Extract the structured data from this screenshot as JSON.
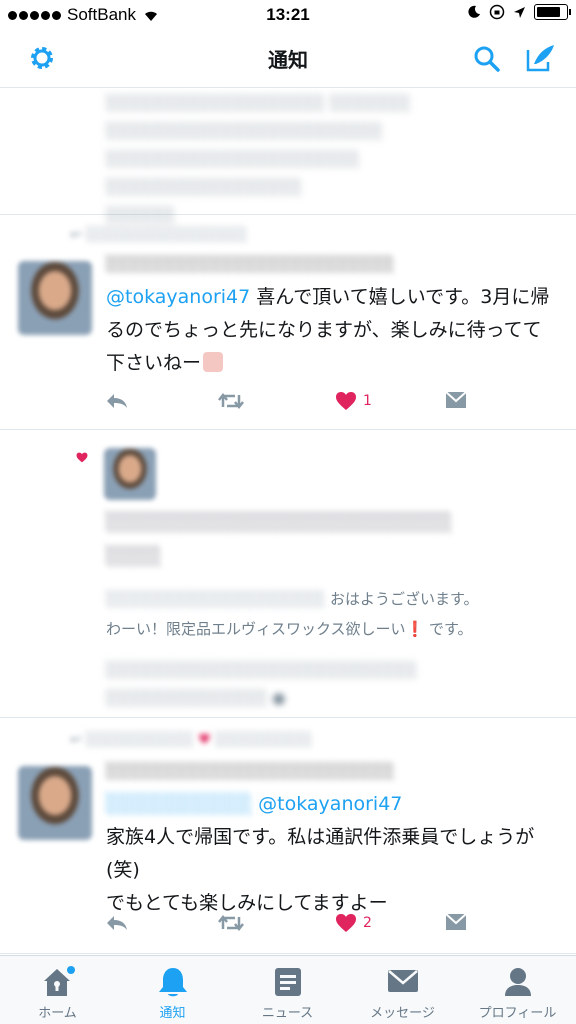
{
  "status_bar": {
    "carrier": "SoftBank",
    "time": "13:21",
    "battery_fraction": 0.85
  },
  "header": {
    "title": "通知",
    "left_icon": "gear-icon",
    "right_icons": [
      "search-icon",
      "compose-tweet-icon"
    ]
  },
  "tweets": [
    {
      "body_mention": "@tokayanori47",
      "body_text": " 喜んで頂いて嬉しいです。3月に帰るのでちょっと先になりますが、楽しみに待ってて下さいねー",
      "like_count": "1"
    },
    {
      "visible_reply": "おはようございます。",
      "visible_line2": "わーい！限定品エルヴィスワックス欲しーい",
      "visible_line2_suffix": " です。"
    },
    {
      "body_mention": "@tokayanori47",
      "body_line1": "家族4人で帰国です。私は通訳件添乗員でしょうが(笑)",
      "body_line2": "でもとても楽しみにしてますよー",
      "like_count": "2"
    }
  ],
  "tab_bar": {
    "tabs": [
      {
        "label": "ホーム",
        "icon": "home-icon"
      },
      {
        "label": "通知",
        "icon": "notifications-bell-icon",
        "active": true
      },
      {
        "label": "ニュース",
        "icon": "news-icon"
      },
      {
        "label": "メッセージ",
        "icon": "envelope-icon"
      },
      {
        "label": "プロフィール",
        "icon": "profile-icon"
      }
    ]
  },
  "colors": {
    "accent": "#1da1f2",
    "like": "#e0245e",
    "icon_gray": "#8899a6"
  }
}
